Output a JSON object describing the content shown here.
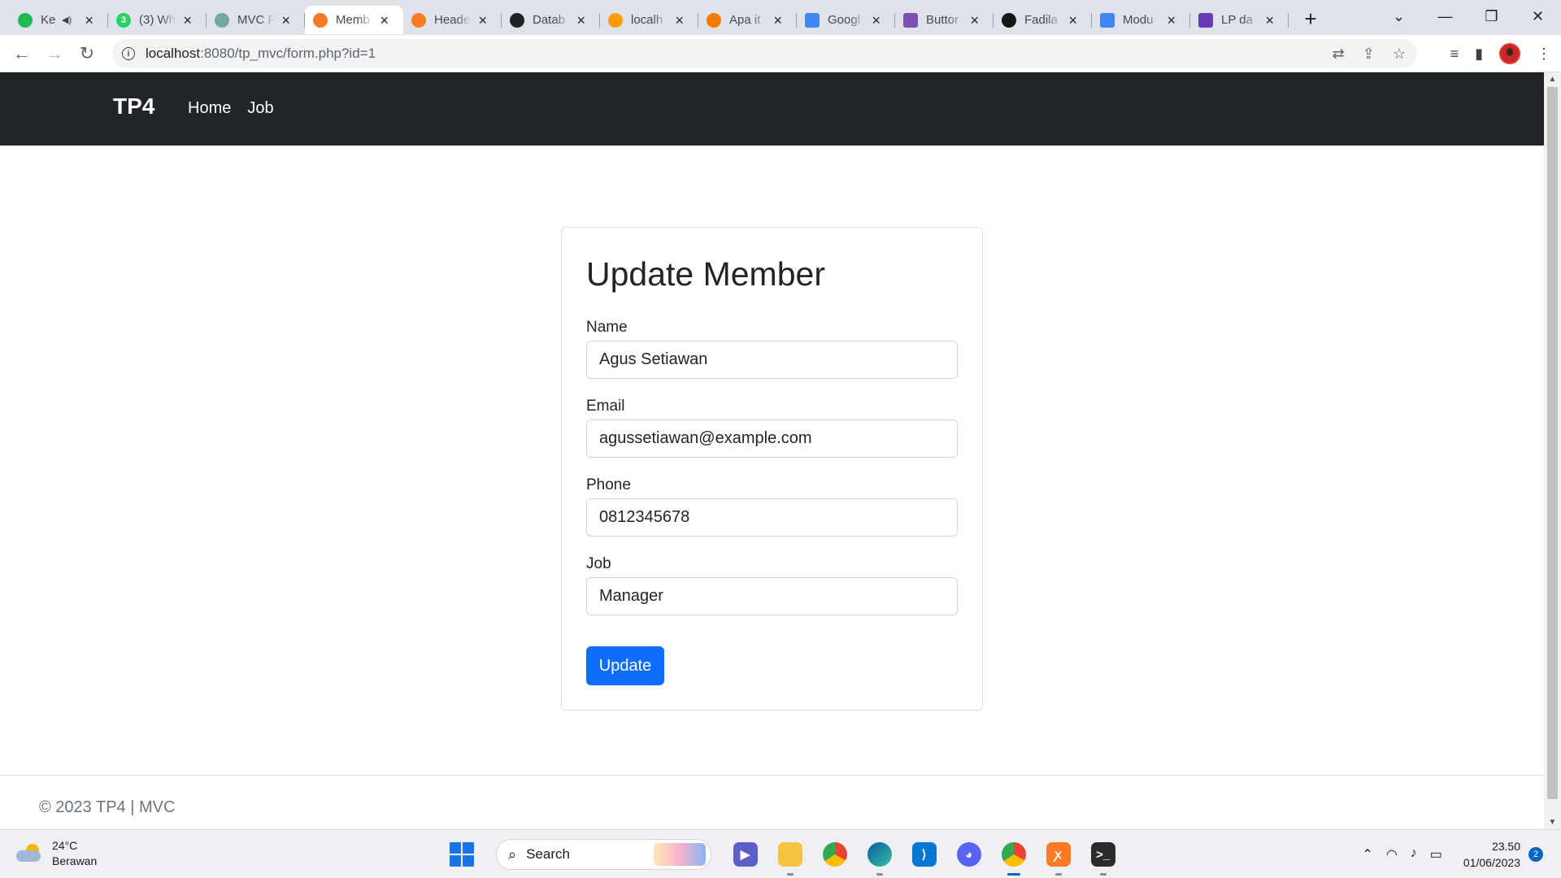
{
  "browser": {
    "tabs": [
      {
        "title": "Ke",
        "favicon": "spotify-icon",
        "color": "#1db954",
        "muted": true
      },
      {
        "title": "(3) Wh",
        "favicon": "whatsapp-icon",
        "color": "#25d366",
        "badge": "3"
      },
      {
        "title": "MVC P",
        "favicon": "chatgpt-icon",
        "color": "#74aa9c"
      },
      {
        "title": "Memb",
        "favicon": "xampp-icon",
        "color": "#fb7a24",
        "active": true
      },
      {
        "title": "Heade",
        "favicon": "xampp-icon",
        "color": "#fb7a24"
      },
      {
        "title": "Datab",
        "favicon": "edge-e-icon",
        "color": "#202124"
      },
      {
        "title": "localh",
        "favicon": "phpmyadmin-icon",
        "color": "#f89c0e"
      },
      {
        "title": "Apa it",
        "favicon": "box-icon",
        "color": "#f57c00"
      },
      {
        "title": "Googl",
        "favicon": "google-translate-icon",
        "color": "#4285f4"
      },
      {
        "title": "Buttor",
        "favicon": "bootstrap-icon",
        "color": "#7952b3"
      },
      {
        "title": "Fadila",
        "favicon": "github-icon",
        "color": "#181717"
      },
      {
        "title": "Modu",
        "favicon": "google-docs-icon",
        "color": "#4285f4"
      },
      {
        "title": "LP da",
        "favicon": "forms-icon",
        "color": "#673ab7"
      }
    ],
    "new_tab": "+",
    "window_controls": {
      "tab_search": "⌄",
      "minimize": "—",
      "restore": "❐",
      "close": "✕"
    },
    "url_host": "localhost",
    "url_rest": ":8080/tp_mvc/form.php?id=1"
  },
  "page": {
    "brand": "TP4",
    "nav": {
      "home": "Home",
      "job": "Job"
    },
    "form": {
      "title": "Update Member",
      "name_label": "Name",
      "name_value": "Agus Setiawan",
      "email_label": "Email",
      "email_value": "agussetiawan@example.com",
      "phone_label": "Phone",
      "phone_value": "0812345678",
      "job_label": "Job",
      "job_value": "Manager",
      "submit": "Update"
    },
    "footer": "© 2023 TP4 | MVC",
    "colors": {
      "navbar": "#212529",
      "primary": "#0d6efd"
    }
  },
  "taskbar": {
    "weather_temp": "24°C",
    "weather_condition": "Berawan",
    "search_label": "Search",
    "time": "23.50",
    "date": "01/06/2023",
    "notification_count": "2"
  }
}
